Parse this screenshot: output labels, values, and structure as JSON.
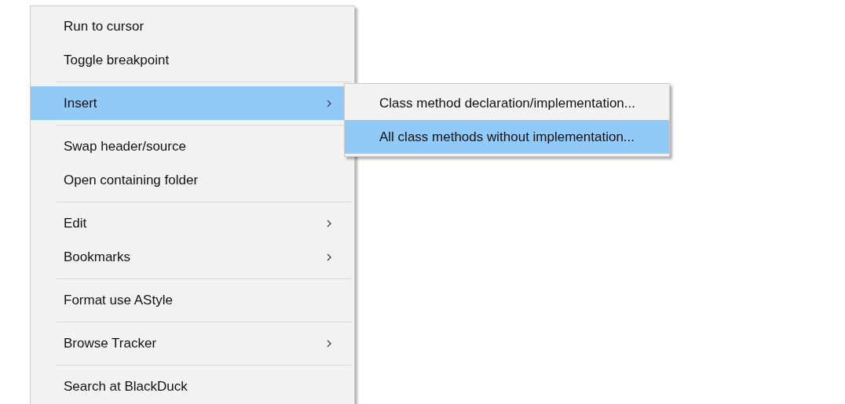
{
  "context_menu": {
    "items": [
      {
        "kind": "item",
        "label": "Run to cursor",
        "selected": false,
        "has_submenu": false
      },
      {
        "kind": "item",
        "label": "Toggle breakpoint",
        "selected": false,
        "has_submenu": false
      },
      {
        "kind": "separator"
      },
      {
        "kind": "item",
        "label": "Insert",
        "selected": true,
        "has_submenu": true,
        "submenu": [
          {
            "label": "Class method declaration/implementation...",
            "selected": false
          },
          {
            "label": "All class methods without implementation...",
            "selected": true
          }
        ]
      },
      {
        "kind": "separator"
      },
      {
        "kind": "item",
        "label": "Swap header/source",
        "selected": false,
        "has_submenu": false
      },
      {
        "kind": "item",
        "label": "Open containing folder",
        "selected": false,
        "has_submenu": false
      },
      {
        "kind": "separator"
      },
      {
        "kind": "item",
        "label": "Edit",
        "selected": false,
        "has_submenu": true
      },
      {
        "kind": "item",
        "label": "Bookmarks",
        "selected": false,
        "has_submenu": true
      },
      {
        "kind": "separator"
      },
      {
        "kind": "item",
        "label": "Format use AStyle",
        "selected": false,
        "has_submenu": false
      },
      {
        "kind": "separator"
      },
      {
        "kind": "item",
        "label": "Browse Tracker",
        "selected": false,
        "has_submenu": true
      },
      {
        "kind": "separator"
      },
      {
        "kind": "item",
        "label": "Search at BlackDuck",
        "selected": false,
        "has_submenu": false
      }
    ]
  }
}
